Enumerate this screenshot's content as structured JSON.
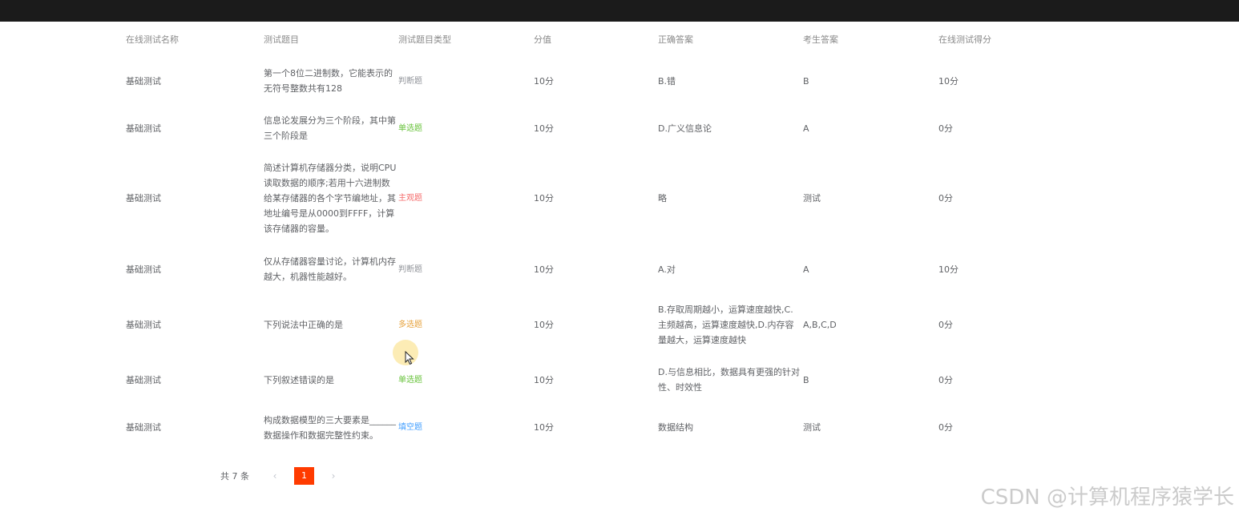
{
  "headers": [
    "在线测试名称",
    "测试题目",
    "测试题目类型",
    "分值",
    "正确答案",
    "考生答案",
    "在线测试得分"
  ],
  "type_colors": {
    "判断题": "#909399",
    "单选题": "#67c23a",
    "主观题": "#f56c6c",
    "多选题": "#e6a23c",
    "填空题": "#409eff"
  },
  "rows": [
    {
      "name": "基础测试",
      "question": "第一个8位二进制数，它能表示的无符号整数共有128",
      "type": "判断题",
      "score": "10分",
      "correct": "B.错",
      "answer": "B",
      "result": "10分",
      "height": 60
    },
    {
      "name": "基础测试",
      "question": "信息论发展分为三个阶段，其中第三个阶段是",
      "type": "单选题",
      "score": "10分",
      "correct": "D.广义信息论",
      "answer": "A",
      "result": "0分",
      "height": 58
    },
    {
      "name": "基础测试",
      "question": "简述计算机存储器分类，说明CPU读取数据的顺序;若用十六进制数给某存储器的各个字节编地址，其地址编号是从0000到FFFF，计算该存储器的容量。",
      "type": "主观题",
      "score": "10分",
      "correct": "略",
      "answer": "测试",
      "result": "0分",
      "height": 117
    },
    {
      "name": "基础测试",
      "question": "仅从存储器容量讨论，计算机内存越大，机器性能越好。",
      "type": "判断题",
      "score": "10分",
      "correct": "A.对",
      "answer": "A",
      "result": "10分",
      "height": 60
    },
    {
      "name": "基础测试",
      "question": "下列说法中正确的是",
      "type": "多选题",
      "score": "10分",
      "correct": "B.存取周期越小，运算速度越快,C.主频越高，运算速度越快,D.内存容量越大，运算速度越快",
      "answer": "A,B,C,D",
      "result": "0分",
      "height": 78
    },
    {
      "name": "基础测试",
      "question": "下列叙述错误的是",
      "type": "单选题",
      "score": "10分",
      "correct": "D.与信息相比，数据具有更强的针对性、时效性",
      "answer": "B",
      "result": "0分",
      "height": 60
    },
    {
      "name": "基础测试",
      "question": "构成数据模型的三大要素是______数据操作和数据完整性约束。",
      "type": "填空题",
      "score": "10分",
      "correct": "数据结构",
      "answer": "测试",
      "result": "0分",
      "height": 59
    }
  ],
  "pagination": {
    "total_label": "共 7 条",
    "prev": "‹",
    "current": "1",
    "next": "›"
  },
  "watermark": "CSDN @计算机程序猿学长"
}
